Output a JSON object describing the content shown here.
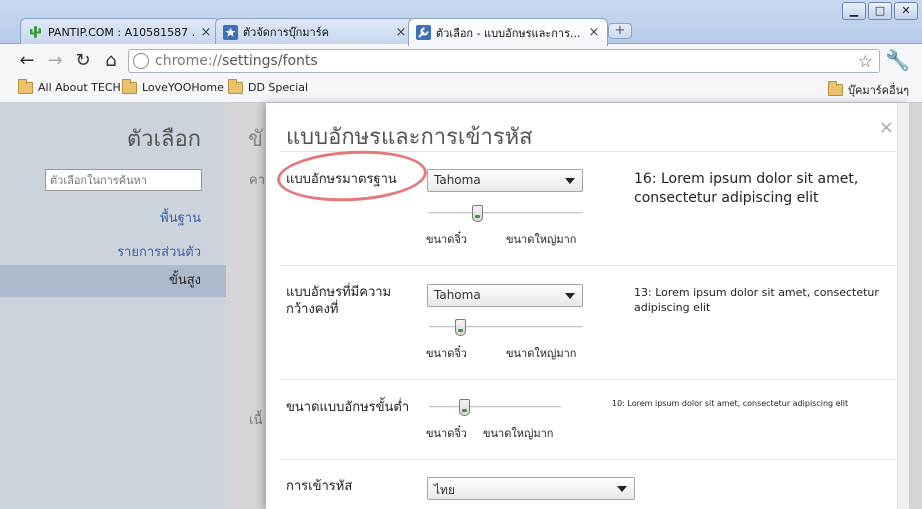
{
  "tabs": [
    {
      "title": "PANTIP.COM : A10581587 ...",
      "icon": "cactus-icon"
    },
    {
      "title": "ตัวจัดการบุ๊กมาร์ค",
      "icon": "star-icon"
    },
    {
      "title": "ตัวเลือก - แบบอักษรและการ...",
      "icon": "wrench-icon"
    }
  ],
  "toolbar": {
    "url_scheme": "chrome://",
    "url_path": "settings/fonts"
  },
  "bookmarks": {
    "items": [
      "All About TECH",
      "LoveYOOHome",
      "DD Special"
    ],
    "other": "บุ๊คมาร์คอื่นๆ"
  },
  "sidebar": {
    "title": "ตัวเลือก",
    "search_placeholder": "ตัวเลือกในการค้นหา",
    "items": [
      "พื้นฐาน",
      "รายการส่วนตัว",
      "ขั้นสูง"
    ]
  },
  "behind": {
    "title": "ขั",
    "line1": "คา",
    "line2": "เนื้"
  },
  "dialog": {
    "title": "แบบอักษรและการเข้ารหัส",
    "close": "×",
    "standard": {
      "label": "แบบอักษรมาตรฐาน",
      "font": "Tahoma",
      "min_label": "ขนาดจิ๋ว",
      "max_label": "ขนาดใหญ่มาก",
      "sample": "16: Lorem ipsum dolor sit amet, consectetur adipiscing elit",
      "size_level": 0.3
    },
    "fixed": {
      "label": "แบบอักษรที่มีความกว้างคงที่",
      "font": "Tahoma",
      "min_label": "ขนาดจิ๋ว",
      "max_label": "ขนาดใหญ่มาก",
      "sample": "13: Lorem ipsum dolor sit amet, consectetur adipiscing elit",
      "size_level": 0.18
    },
    "minimum": {
      "label": "ขนาดแบบอักษรขั้นต่ำ",
      "min_label": "ขนาดจิ๋ว",
      "max_label": "ขนาดใหญ่มาก",
      "sample": "10: Lorem ipsum dolor sit amet, consectetur adipiscing elit",
      "size_level": 0.25
    },
    "encoding": {
      "label": "การเข้ารหัส",
      "value": "ไทย"
    }
  },
  "colors": {
    "highlight_ring": "#e5797a",
    "link": "#3a63a8"
  }
}
